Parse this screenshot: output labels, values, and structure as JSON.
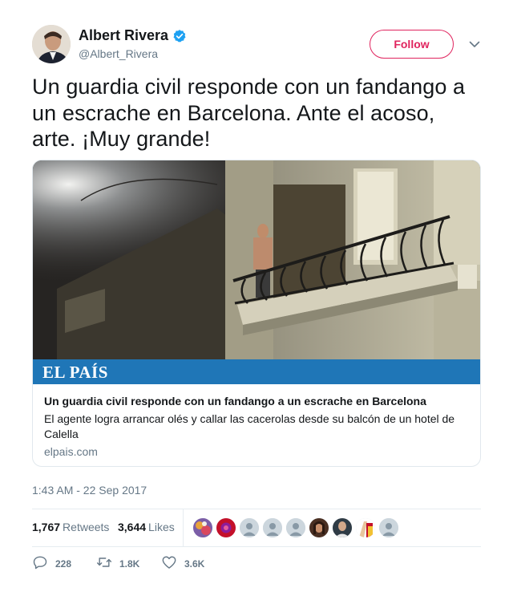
{
  "author": {
    "display_name": "Albert Rivera",
    "handle": "@Albert_Rivera",
    "verified": true
  },
  "follow_button": {
    "label": "Follow"
  },
  "tweet": {
    "text": "Un guardia civil responde con un fandango a un escrache en Barcelona. Ante el acoso, arte. ¡Muy grande!",
    "timestamp": "1:43 AM - 22 Sep 2017"
  },
  "card": {
    "brand": "EL PAÍS",
    "title": "Un guardia civil responde con un fandango a un escrache en Barcelona",
    "description": "El agente logra arrancar olés y callar las cacerolas desde su balcón de un hotel de Calella",
    "domain": "elpais.com"
  },
  "stats": {
    "retweets": {
      "count": "1,767",
      "label": "Retweets"
    },
    "likes": {
      "count": "3,644",
      "label": "Likes"
    }
  },
  "actions": {
    "reply_count": "228",
    "retweet_count": "1.8K",
    "like_count": "3.6K"
  },
  "colors": {
    "accent_like": "#e0245e",
    "verified_blue": "#1da1f2",
    "brand_bar": "#1f76b7",
    "secondary_text": "#657786",
    "primary_text": "#14171a",
    "border": "#e1e8ed"
  },
  "icons": {
    "verified": "verified-badge-icon",
    "caret": "chevron-down-icon",
    "reply": "reply-icon",
    "retweet": "retweet-icon",
    "like": "heart-icon"
  }
}
